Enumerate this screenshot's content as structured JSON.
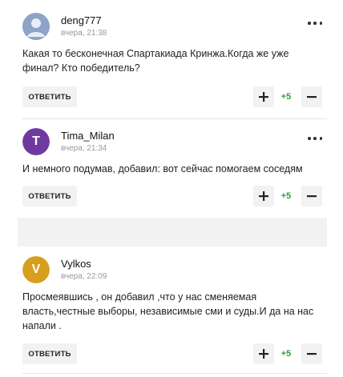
{
  "reply_label": "ОТВЕТИТЬ",
  "colors": {
    "score": "#2e9e41",
    "avatar_t": "#6f3aa0",
    "avatar_v": "#d6a01d",
    "avatar_default": "#8ea3c7"
  },
  "comments": [
    {
      "username": "deng777",
      "date": "вчера, 21:38",
      "avatar_letter": "",
      "text": "Какая то бесконечная Спартакиада Кринжа.Когда же уже финал? Кто победитель?",
      "score": "+5"
    },
    {
      "username": "Tima_Milan",
      "date": "вчера, 21:34",
      "avatar_letter": "T",
      "text": "И немного подумав, добавил: вот сейчас помогаем соседям",
      "score": "+5"
    },
    {
      "username": "Vylkos",
      "date": "вчера, 22:09",
      "avatar_letter": "V",
      "text": "Просмеявшись , он добавил ,что у нас сменяемая власть,честные выборы, независимые сми и суды.И да на нас напали .",
      "score": "+5"
    }
  ]
}
